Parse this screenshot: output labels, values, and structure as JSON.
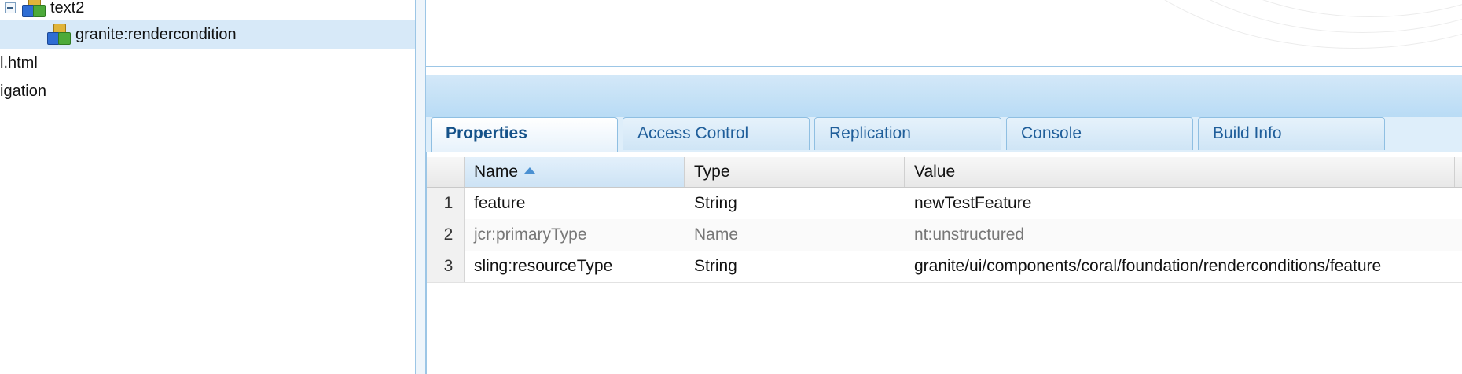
{
  "tree": {
    "items": [
      {
        "label": "text2"
      },
      {
        "label": "granite:rendercondition"
      },
      {
        "label": "l.html"
      },
      {
        "label": "igation"
      }
    ]
  },
  "tabs": [
    {
      "label": "Properties"
    },
    {
      "label": "Access Control"
    },
    {
      "label": "Replication"
    },
    {
      "label": "Console"
    },
    {
      "label": "Build Info"
    }
  ],
  "grid": {
    "columns": [
      {
        "label": "Name"
      },
      {
        "label": "Type"
      },
      {
        "label": "Value"
      }
    ],
    "rows": [
      {
        "num": "1",
        "name": "feature",
        "type": "String",
        "value": "newTestFeature"
      },
      {
        "num": "2",
        "name": "jcr:primaryType",
        "type": "Name",
        "value": "nt:unstructured"
      },
      {
        "num": "3",
        "name": "sling:resourceType",
        "type": "String",
        "value": "granite/ui/components/coral/foundation/renderconditions/feature"
      }
    ]
  },
  "colors": {
    "accent": "#1f5e9a",
    "selected_row": "#d7e9f8",
    "panel_border": "#9cc6e6"
  }
}
